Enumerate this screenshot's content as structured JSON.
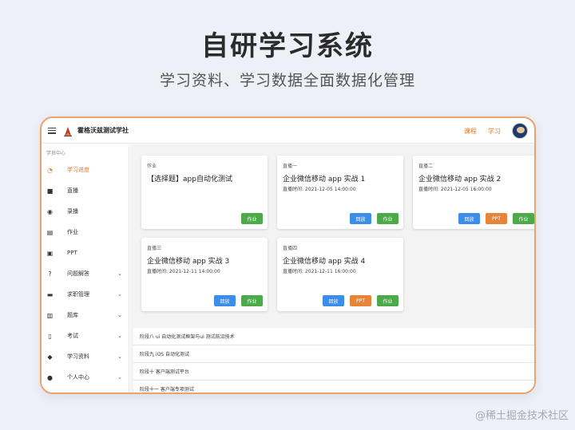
{
  "hero": {
    "title": "自研学习系统",
    "subtitle": "学习资料、学习数据全面数据化管理"
  },
  "topbar": {
    "brand": "霍格沃兹测试学社",
    "nav": [
      "课程",
      "学习"
    ]
  },
  "sidebar": {
    "heading": "学员中心",
    "items": [
      {
        "label": "学习进度",
        "icon": "progress-icon",
        "active": true,
        "expandable": false
      },
      {
        "label": "直播",
        "icon": "video-camera-icon",
        "active": false,
        "expandable": false
      },
      {
        "label": "录播",
        "icon": "record-icon",
        "active": false,
        "expandable": false
      },
      {
        "label": "作业",
        "icon": "homework-icon",
        "active": false,
        "expandable": false
      },
      {
        "label": "PPT",
        "icon": "ppt-icon",
        "active": false,
        "expandable": false
      },
      {
        "label": "问题解答",
        "icon": "question-icon",
        "active": false,
        "expandable": true
      },
      {
        "label": "求职管理",
        "icon": "briefcase-icon",
        "active": false,
        "expandable": true
      },
      {
        "label": "题库",
        "icon": "question-bank-icon",
        "active": false,
        "expandable": true
      },
      {
        "label": "考试",
        "icon": "exam-icon",
        "active": false,
        "expandable": true
      },
      {
        "label": "学习资料",
        "icon": "graduation-cap-icon",
        "active": false,
        "expandable": true
      },
      {
        "label": "个人中心",
        "icon": "user-icon",
        "active": false,
        "expandable": true
      }
    ]
  },
  "cards": [
    {
      "tag": "作业",
      "title": "【选择题】app自动化测试",
      "time": "",
      "buttons": [
        "作业"
      ]
    },
    {
      "tag": "直播一",
      "title": "企业微信移动 app 实战 1",
      "time": "直播时间: 2021-12-05 14:00:00",
      "buttons": [
        "回放",
        "作业"
      ]
    },
    {
      "tag": "直播二",
      "title": "企业微信移动 app 实战 2",
      "time": "直播时间: 2021-12-05 16:00:00",
      "buttons": [
        "回放",
        "PPT",
        "作业"
      ]
    },
    {
      "tag": "直播三",
      "title": "企业微信移动 app 实战 3",
      "time": "直播时间: 2021-12-11 14:00:00",
      "buttons": [
        "回放",
        "作业"
      ]
    },
    {
      "tag": "直播四",
      "title": "企业微信移动 app 实战 4",
      "time": "直播时间: 2021-12-11 16:00:00",
      "buttons": [
        "回放",
        "PPT",
        "作业"
      ]
    }
  ],
  "stages": [
    "阶段八 ui 自动化测试框架与ui 测试前沿技术",
    "阶段九 iOS 自动化测试",
    "阶段十 客户端测试平台",
    "阶段十一 客户端专项测试"
  ],
  "colors": {
    "accent": "#e07b2a",
    "blue": "#3d8ee8",
    "orange": "#e6843a",
    "green": "#4caa4a"
  },
  "watermark": "@稀土掘金技术社区"
}
